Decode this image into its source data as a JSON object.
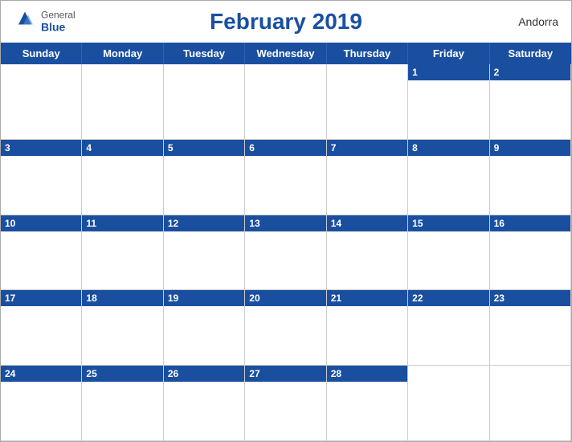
{
  "header": {
    "title": "February 2019",
    "country": "Andorra",
    "logo": {
      "general": "General",
      "blue": "Blue"
    }
  },
  "weekdays": [
    "Sunday",
    "Monday",
    "Tuesday",
    "Wednesday",
    "Thursday",
    "Friday",
    "Saturday"
  ],
  "weeks": [
    [
      null,
      null,
      null,
      null,
      null,
      1,
      2
    ],
    [
      3,
      4,
      5,
      6,
      7,
      8,
      9
    ],
    [
      10,
      11,
      12,
      13,
      14,
      15,
      16
    ],
    [
      17,
      18,
      19,
      20,
      21,
      22,
      23
    ],
    [
      24,
      25,
      26,
      27,
      28,
      null,
      null
    ]
  ],
  "colors": {
    "blue": "#1a4fa0",
    "header_border": "#3060b0"
  }
}
